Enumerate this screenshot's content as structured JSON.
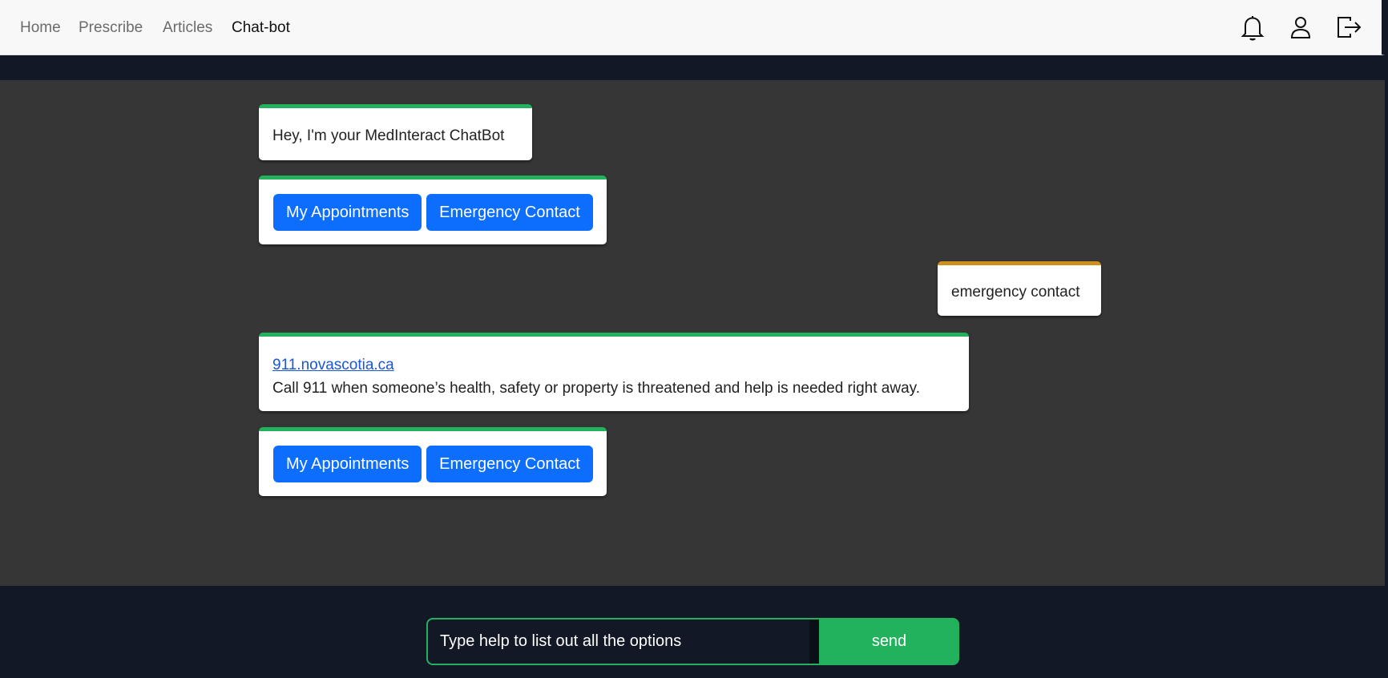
{
  "nav": {
    "links": [
      {
        "label": "Home"
      },
      {
        "label": "Prescribe"
      },
      {
        "label": "Articles"
      },
      {
        "label": "Chat-bot"
      }
    ],
    "icons": [
      "bell-icon",
      "user-icon",
      "logout-icon"
    ]
  },
  "chat": {
    "greeting": "Hey, I'm your MedInteract ChatBot",
    "options_1": [
      "My Appointments",
      "Emergency Contact"
    ],
    "user_message": "emergency contact",
    "response": {
      "link_text": "911.novascotia.ca",
      "text": "Call 911 when someone’s health, safety or property is threatened and help is needed right away."
    },
    "options_2": [
      "My Appointments",
      "Emergency Contact"
    ]
  },
  "composer": {
    "placeholder": "Type help to list out all the options",
    "send_label": "send"
  },
  "colors": {
    "bot_accent": "#22b15c",
    "user_accent": "#cf8f1c",
    "button_primary": "#0d6efd",
    "chat_background": "#363636",
    "page_background": "#121826"
  }
}
